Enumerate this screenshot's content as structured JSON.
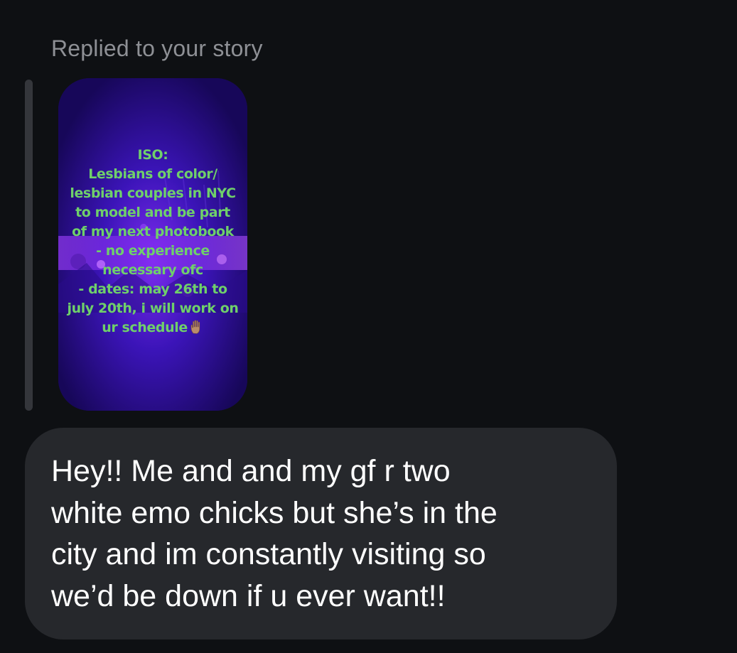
{
  "reply": {
    "label": "Replied to your story"
  },
  "story": {
    "lines": [
      "ISO:",
      "Lesbians of color/",
      "lesbian couples in NYC",
      "to model and be part",
      "of my next photobook",
      "- no experience",
      "necessary ofc",
      "- dates: may 26th to",
      "july 20th, i will work on",
      "ur schedule"
    ],
    "emoji": "raised-hand-icon",
    "text_color": "#6fd06a",
    "background_color": "#1a0a5a"
  },
  "message": {
    "lines": [
      "Hey!! Me and and my gf r two",
      "white emo chicks but she’s in the",
      "city and im constantly visiting so",
      "we’d be down if u ever want!!"
    ],
    "bubble_color": "#26282c"
  }
}
